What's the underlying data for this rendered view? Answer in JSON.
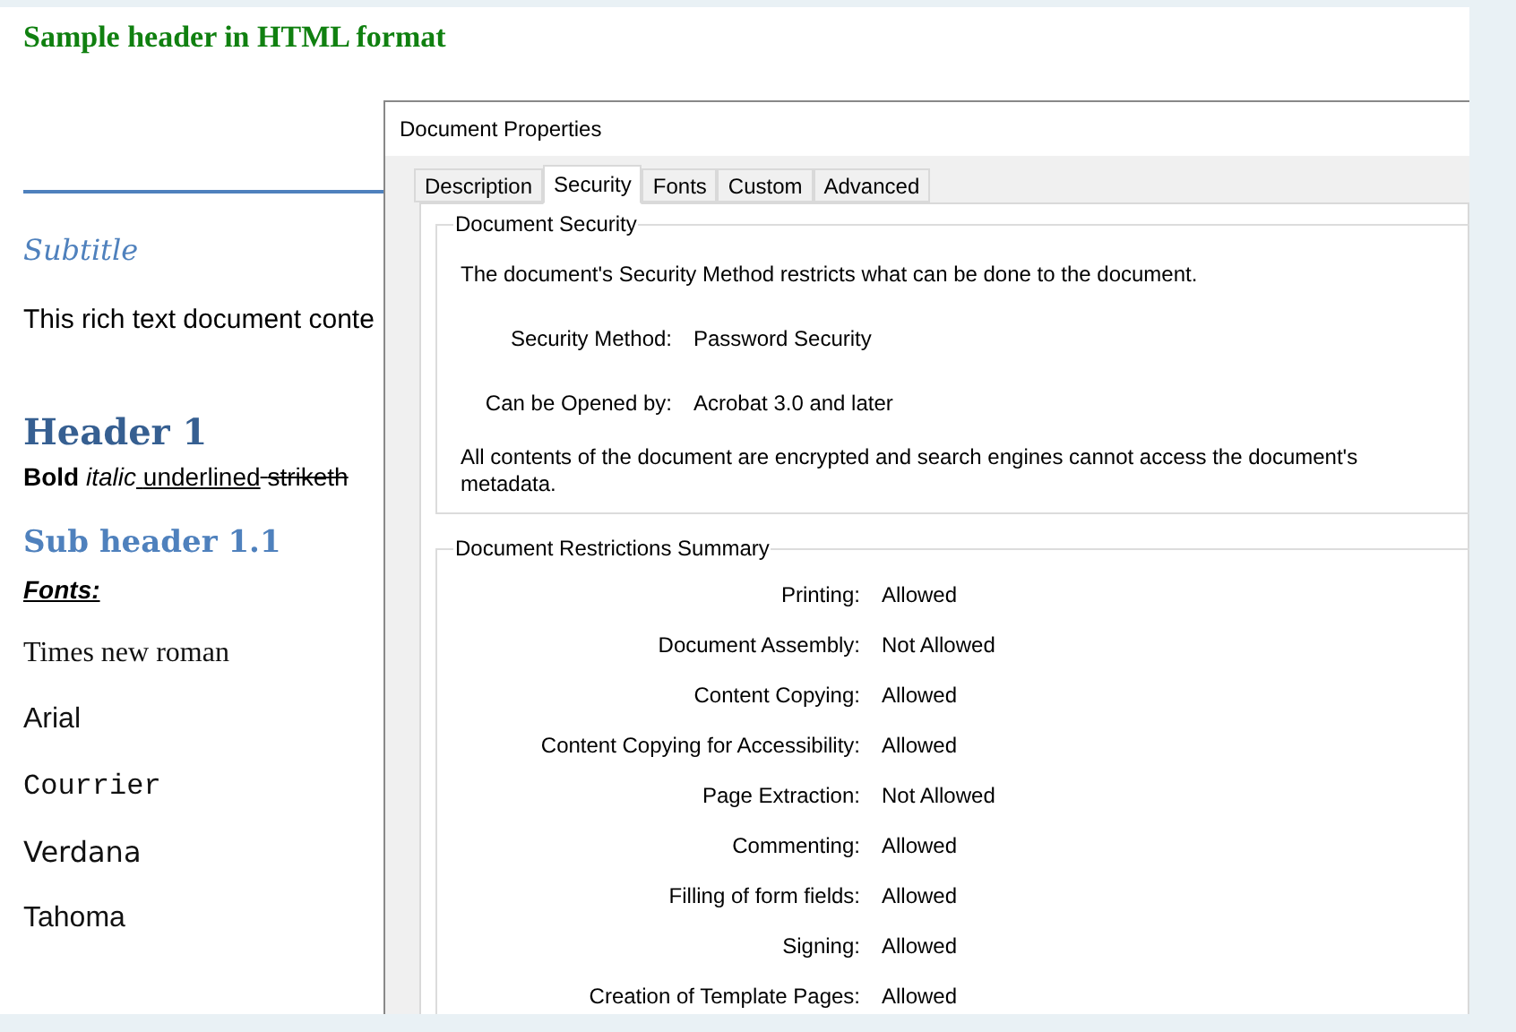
{
  "document": {
    "title": "Sample header in HTML format",
    "subtitle": "Subtitle",
    "intro": "This rich text document conte",
    "header_1": "Header 1",
    "format_line": [
      {
        "kind": "bold",
        "text": "Bold"
      },
      {
        "kind": "italic",
        "text": "italic"
      },
      {
        "kind": "underline",
        "text": "underlined"
      },
      {
        "kind": "strike",
        "text": "striketh"
      }
    ],
    "sub_header": "Sub header 1.1",
    "fonts_label": "Fonts:",
    "fonts": [
      {
        "kind": "serif",
        "text": "Times new roman"
      },
      {
        "kind": "sans",
        "text": "Arial"
      },
      {
        "kind": "mono",
        "text": "Courrier"
      },
      {
        "kind": "wide",
        "text": "Verdana"
      },
      {
        "kind": "sans",
        "text": "Tahoma"
      }
    ]
  },
  "dialog": {
    "title": "Document Properties",
    "tabs": [
      {
        "label": "Description",
        "selected": false
      },
      {
        "label": "Security",
        "selected": true
      },
      {
        "label": "Fonts",
        "selected": false
      },
      {
        "label": "Custom",
        "selected": false
      },
      {
        "label": "Advanced",
        "selected": false
      }
    ],
    "security_group": {
      "legend": "Document Security",
      "intro": "The document's Security Method restricts what can be done to the document.",
      "fields": [
        {
          "label": "Security Method:",
          "value": "Password Security"
        },
        {
          "label": "Can be Opened by:",
          "value": "Acrobat 3.0 and later"
        }
      ],
      "note": "All contents of the document are encrypted and search engines cannot access the document's metadata."
    },
    "restrictions_group": {
      "legend": "Document Restrictions Summary",
      "rows": [
        {
          "label": "Printing:",
          "value": "Allowed"
        },
        {
          "label": "Document Assembly:",
          "value": "Not Allowed"
        },
        {
          "label": "Content Copying:",
          "value": "Allowed"
        },
        {
          "label": "Content Copying for Accessibility:",
          "value": "Allowed"
        },
        {
          "label": "Page Extraction:",
          "value": "Not Allowed"
        },
        {
          "label": "Commenting:",
          "value": "Allowed"
        },
        {
          "label": "Filling of form fields:",
          "value": "Allowed"
        },
        {
          "label": "Signing:",
          "value": "Allowed"
        },
        {
          "label": "Creation of Template Pages:",
          "value": "Allowed"
        }
      ]
    }
  }
}
